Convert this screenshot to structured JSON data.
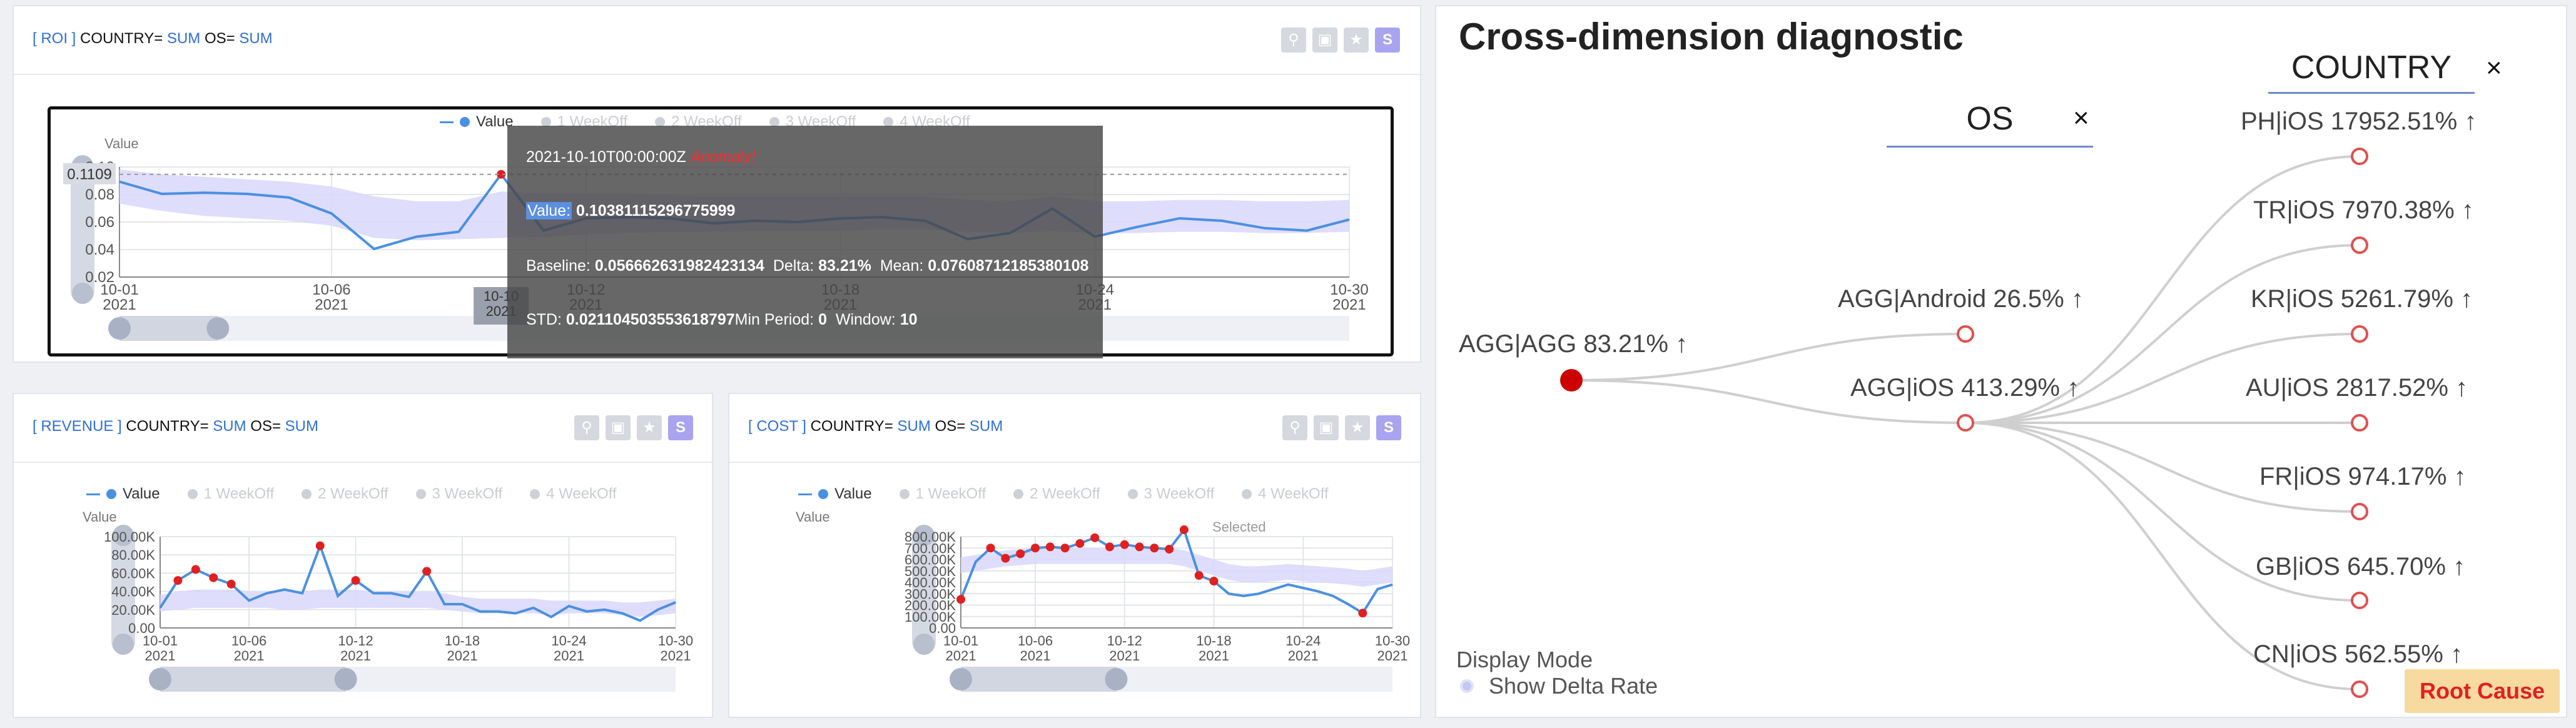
{
  "colors": {
    "accent": "#2f6fd6",
    "line": "#4a90e2",
    "band": "#d9d7fb",
    "anomaly": "#e02020",
    "node": "#e05050",
    "root_node": "#cc0000"
  },
  "panels": {
    "roi": {
      "title_tag": "[ ROI ]",
      "title_rest": " COUNTRY= ",
      "title_kw1": "SUM",
      "title_os": " OS= ",
      "title_kw2": "SUM",
      "actions": [
        "chart-icon",
        "image-icon",
        "star-icon",
        "S"
      ]
    },
    "revenue": {
      "title_tag": "[ REVENUE ]",
      "title_rest": " COUNTRY= ",
      "title_kw1": "SUM",
      "title_os": " OS= ",
      "title_kw2": "SUM",
      "actions": [
        "chart-icon",
        "image-icon",
        "star-icon",
        "S"
      ]
    },
    "cost": {
      "title_tag": "[ COST ]",
      "title_rest": " COUNTRY= ",
      "title_kw1": "SUM",
      "title_os": " OS= ",
      "title_kw2": "SUM",
      "actions": [
        "chart-icon",
        "image-icon",
        "star-icon",
        "S"
      ]
    }
  },
  "legend": [
    "Value",
    "1 WeekOff",
    "2 WeekOff",
    "3 WeekOff",
    "4 WeekOff"
  ],
  "y_name": "Value",
  "selected_label": "Selected",
  "tooltip": {
    "date": "2021-10-10T00:00:00Z",
    "anomaly": "Anomaly!",
    "value_label": "Value:",
    "value": "0.10381115296775999",
    "baseline_label": "Baseline:",
    "baseline": "0.056662631982423134",
    "delta_label": "Delta:",
    "delta": "83.21%",
    "mean_label": "Mean:",
    "mean": "0.07608712185380108",
    "std_label": "STD:",
    "std": "0.021104503553618797",
    "min_period_label": "Min Period:",
    "min_period": "0",
    "window_label": "Window:",
    "window": "10"
  },
  "roi_cursor_value": "0.1109",
  "roi_cursor_date": "10-10",
  "roi_cursor_year": "2021",
  "chart_data": [
    {
      "type": "line",
      "title": "[ ROI ] COUNTRY= SUM OS= SUM",
      "ylabel": "Value",
      "ylim": [
        0.02,
        0.11
      ],
      "yticks": [
        "0.10",
        "0.08",
        "0.06",
        "0.04",
        "0.02"
      ],
      "xticks": [
        "10-01",
        "10-06",
        "10-12",
        "10-18",
        "10-24",
        "10-30"
      ],
      "xtick_year": "2021",
      "x": [
        "10-01",
        "10-02",
        "10-03",
        "10-04",
        "10-05",
        "10-06",
        "10-07",
        "10-08",
        "10-09",
        "10-10",
        "10-11",
        "10-12",
        "10-13",
        "10-14",
        "10-15",
        "10-16",
        "10-17",
        "10-18",
        "10-19",
        "10-20",
        "10-21",
        "10-22",
        "10-23",
        "10-24",
        "10-25",
        "10-26",
        "10-27",
        "10-28",
        "10-29",
        "10-30"
      ],
      "series": [
        {
          "name": "Value",
          "values": [
            0.098,
            0.088,
            0.089,
            0.088,
            0.085,
            0.072,
            0.043,
            0.053,
            0.057,
            0.104,
            0.058,
            0.068,
            0.069,
            0.068,
            0.064,
            0.066,
            0.065,
            0.068,
            0.069,
            0.066,
            0.051,
            0.056,
            0.076,
            0.053,
            0.061,
            0.068,
            0.066,
            0.06,
            0.058,
            0.067
          ]
        }
      ],
      "band_low": [
        0.08,
        0.074,
        0.07,
        0.068,
        0.066,
        0.062,
        0.052,
        0.05,
        0.051,
        0.052,
        0.053,
        0.055,
        0.056,
        0.057,
        0.057,
        0.058,
        0.058,
        0.058,
        0.059,
        0.059,
        0.057,
        0.056,
        0.058,
        0.056,
        0.056,
        0.057,
        0.057,
        0.056,
        0.056,
        0.057
      ],
      "band_high": [
        0.108,
        0.104,
        0.102,
        0.1,
        0.098,
        0.094,
        0.086,
        0.082,
        0.082,
        0.09,
        0.088,
        0.088,
        0.088,
        0.087,
        0.086,
        0.086,
        0.086,
        0.086,
        0.086,
        0.086,
        0.083,
        0.082,
        0.086,
        0.082,
        0.082,
        0.083,
        0.083,
        0.082,
        0.082,
        0.083
      ],
      "anomalies": [
        9
      ]
    },
    {
      "type": "line",
      "title": "[ REVENUE ] COUNTRY= SUM OS= SUM",
      "ylabel": "Value",
      "ylim": [
        0,
        100000
      ],
      "yticks": [
        "100.00K",
        "80.00K",
        "60.00K",
        "40.00K",
        "20.00K",
        "0.00"
      ],
      "xticks": [
        "10-01",
        "10-06",
        "10-12",
        "10-18",
        "10-24",
        "10-30"
      ],
      "xtick_year": "2021",
      "x": [
        "10-01",
        "10-02",
        "10-03",
        "10-04",
        "10-05",
        "10-06",
        "10-07",
        "10-08",
        "10-09",
        "10-10",
        "10-11",
        "10-12",
        "10-13",
        "10-14",
        "10-15",
        "10-16",
        "10-17",
        "10-18",
        "10-19",
        "10-20",
        "10-21",
        "10-22",
        "10-23",
        "10-24",
        "10-25",
        "10-26",
        "10-27",
        "10-28",
        "10-29",
        "10-30"
      ],
      "series": [
        {
          "name": "Value",
          "values": [
            22000,
            52000,
            64000,
            55000,
            48000,
            30000,
            38000,
            42000,
            38000,
            90000,
            35000,
            52000,
            38000,
            38000,
            34000,
            62000,
            26000,
            26000,
            18000,
            18000,
            16000,
            22000,
            12000,
            24000,
            18000,
            20000,
            16000,
            8000,
            20000,
            28000
          ]
        }
      ],
      "band_low": [
        18000,
        20000,
        22000,
        22000,
        22000,
        22000,
        22000,
        20000,
        20000,
        22000,
        22000,
        22000,
        22000,
        22000,
        22000,
        22000,
        20000,
        18000,
        16000,
        16000,
        16000,
        16000,
        14000,
        16000,
        16000,
        16000,
        14000,
        12000,
        14000,
        16000
      ],
      "band_high": [
        36000,
        40000,
        42000,
        42000,
        42000,
        40000,
        40000,
        40000,
        40000,
        42000,
        42000,
        42000,
        40000,
        40000,
        40000,
        40000,
        38000,
        34000,
        32000,
        32000,
        32000,
        32000,
        30000,
        30000,
        30000,
        30000,
        28000,
        28000,
        30000,
        32000
      ],
      "anomalies": [
        1,
        2,
        3,
        4,
        9,
        11,
        15
      ]
    },
    {
      "type": "line",
      "title": "[ COST ] COUNTRY= SUM OS= SUM",
      "ylabel": "Value",
      "ylim": [
        0,
        800000
      ],
      "yticks": [
        "800.00K",
        "700.00K",
        "600.00K",
        "500.00K",
        "400.00K",
        "300.00K",
        "200.00K",
        "100.00K",
        "0.00"
      ],
      "xticks": [
        "10-01",
        "10-06",
        "10-12",
        "10-18",
        "10-24",
        "10-30"
      ],
      "xtick_year": "2021",
      "x": [
        "10-01",
        "10-02",
        "10-03",
        "10-04",
        "10-05",
        "10-06",
        "10-07",
        "10-08",
        "10-09",
        "10-10",
        "10-11",
        "10-12",
        "10-13",
        "10-14",
        "10-15",
        "10-16",
        "10-17",
        "10-18",
        "10-19",
        "10-20",
        "10-21",
        "10-22",
        "10-23",
        "10-24",
        "10-25",
        "10-26",
        "10-27",
        "10-28",
        "10-29",
        "10-30"
      ],
      "series": [
        {
          "name": "Value",
          "values": [
            250000,
            580000,
            700000,
            610000,
            650000,
            700000,
            710000,
            700000,
            740000,
            790000,
            710000,
            730000,
            710000,
            700000,
            690000,
            860000,
            460000,
            410000,
            300000,
            280000,
            300000,
            340000,
            380000,
            350000,
            320000,
            280000,
            210000,
            130000,
            340000,
            380000
          ]
        }
      ],
      "band_low": [
        480000,
        500000,
        520000,
        540000,
        550000,
        560000,
        560000,
        560000,
        560000,
        560000,
        560000,
        560000,
        560000,
        560000,
        560000,
        540000,
        500000,
        460000,
        420000,
        400000,
        400000,
        410000,
        420000,
        410000,
        400000,
        390000,
        380000,
        360000,
        380000,
        400000
      ],
      "band_high": [
        620000,
        640000,
        660000,
        680000,
        690000,
        700000,
        700000,
        700000,
        700000,
        700000,
        700000,
        700000,
        700000,
        700000,
        700000,
        680000,
        640000,
        600000,
        560000,
        540000,
        540000,
        550000,
        560000,
        550000,
        540000,
        530000,
        520000,
        500000,
        520000,
        540000
      ],
      "anomalies": [
        0,
        2,
        3,
        4,
        5,
        6,
        7,
        8,
        9,
        10,
        11,
        12,
        13,
        14,
        15,
        16,
        17,
        27
      ]
    }
  ],
  "diagnostic": {
    "title": "Cross-dimension diagnostic",
    "dim_os": "OS",
    "dim_country": "COUNTRY",
    "close": "×",
    "nodes": {
      "root": "AGG|AGG 83.21% ↑",
      "android": "AGG|Android 26.5% ↑",
      "ios": "AGG|iOS 413.29% ↑",
      "leaves": [
        "PH|iOS 17952.51% ↑",
        "TR|iOS 7970.38% ↑",
        "KR|iOS 5261.79% ↑",
        "AU|iOS 2817.52% ↑",
        "FR|iOS 974.17% ↑",
        "GB|iOS 645.70% ↑",
        "CN|iOS 562.55% ↑"
      ]
    },
    "display_mode": "Display Mode",
    "show_delta": "Show Delta Rate",
    "root_cause": "Root Cause"
  }
}
